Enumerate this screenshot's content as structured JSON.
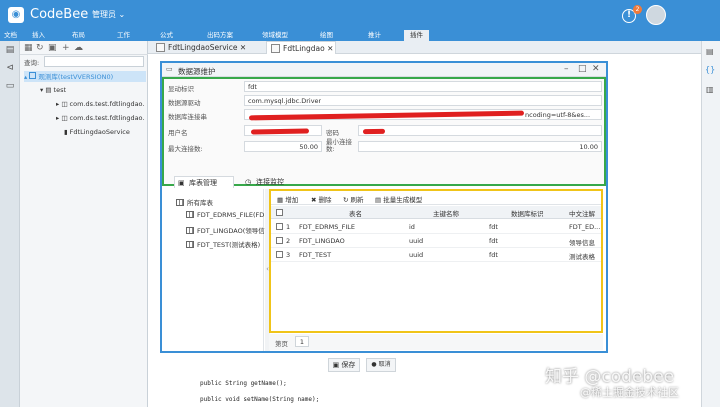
{
  "app": {
    "name": "CodeBee",
    "user_menu": "管理员 ⌄",
    "notifications_count": "2",
    "notification_glyph": "!"
  },
  "menu": [
    "文档",
    "插入",
    "布局",
    "工作",
    "公式",
    "出码方案",
    "领域模型",
    "绘图",
    "推计",
    "插件"
  ],
  "tree": {
    "search_label": "查询:",
    "nodes": [
      "观测库(testVVERSION0)",
      "test",
      "com.ds.test.fdtlingdao.",
      "com.ds.test.fdtlingdao.",
      "FdtLingdaoService"
    ]
  },
  "editor_tabs": [
    {
      "label": "FdtLingdaoService",
      "close": "✕"
    },
    {
      "label": "FdtLingdao",
      "close": "✕"
    }
  ],
  "dialog": {
    "title": "数据源维护",
    "form": {
      "name_label": "显动标识",
      "name_value": "fdt",
      "driver_label": "数据源驱动",
      "driver_value": "com.mysql.jdbc.Driver",
      "url_label": "数据库连接串",
      "url_suffix": "ncoding=utf-8&es...",
      "user_label": "用户名",
      "password_label": "密码",
      "max_conn_label": "最大连接数:",
      "max_conn_value": "50.00",
      "min_conn_label": "最小连接数:",
      "min_conn_value": "10.00"
    },
    "form_tabs": [
      "库表管理",
      "连接监控"
    ],
    "left_tree": [
      "所有库表",
      "FDT_EDRMS_FILE(FD",
      "FDT_LINGDAO(领导信",
      "FDT_TEST(测试表格)"
    ],
    "toolbar": [
      "增加",
      "删除",
      "刷新",
      "批量生成模型"
    ],
    "columns": [
      "表名",
      "主键名称",
      "数据库标识",
      "中文注解"
    ],
    "rows": [
      {
        "idx": "1",
        "table": "FDT_EDRMS_FILE",
        "pk": "id",
        "db": "fdt",
        "cn": "FDT_ED..."
      },
      {
        "idx": "2",
        "table": "FDT_LINGDAO",
        "pk": "uuid",
        "db": "fdt",
        "cn": "领导信息"
      },
      {
        "idx": "3",
        "table": "FDT_TEST",
        "pk": "uuid",
        "db": "fdt",
        "cn": "测试表格"
      }
    ],
    "pager_label": "第页",
    "pager_value": "1",
    "save_label": "保存",
    "close_label": "取消"
  },
  "code_lines": [
    {
      "n": "",
      "t": "public String getName();"
    },
    {
      "n": "",
      "t": "public void setName(String name);"
    }
  ],
  "watermark": {
    "line1": "知乎 @codebee",
    "line2": "@稀土掘金技术社区"
  },
  "colors": {
    "accent": "#3a8fd6",
    "form_box": "#37a84a",
    "grid_box": "#f0c419",
    "redaction": "#e02020"
  }
}
